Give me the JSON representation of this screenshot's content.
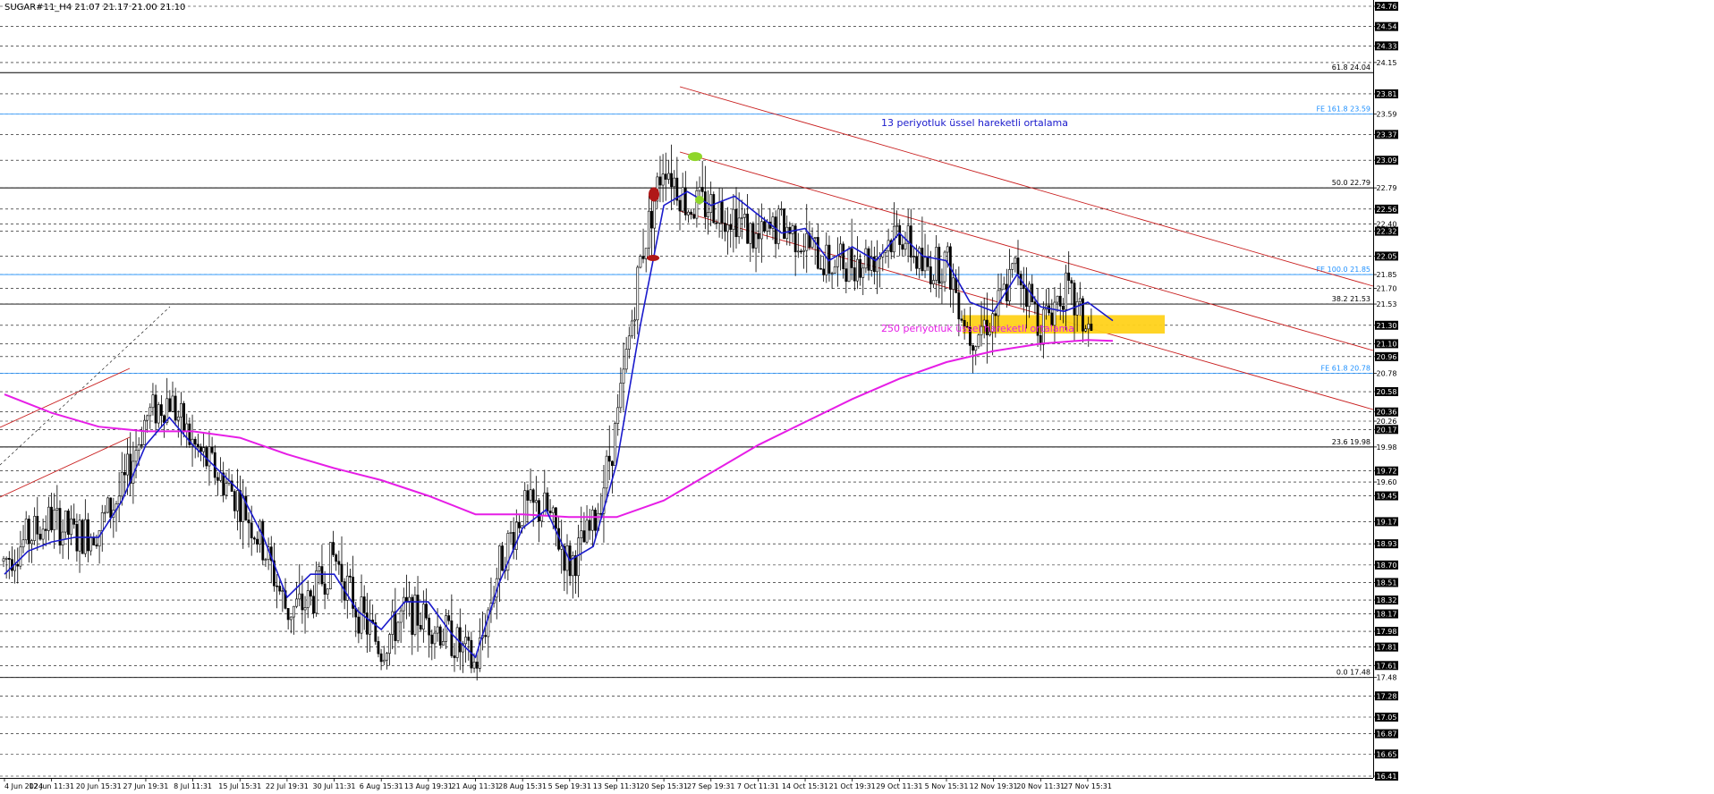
{
  "header": {
    "title": "SUGAR#11_H4  21.07 21.17 21.00 21.10"
  },
  "chart_data": {
    "type": "candlestick",
    "title": "SUGAR#11_H4  21.07 21.17 21.00 21.10",
    "symbol": "SUGAR#11",
    "timeframe": "H4",
    "last_ohlc": {
      "open": 21.07,
      "high": 21.17,
      "low": 21.0,
      "close": 21.1
    },
    "ylim": [
      16.41,
      24.76
    ],
    "grid": "horizontal-dashed",
    "y_tick_labels": [
      "24.76",
      "24.54",
      "24.33",
      "24.15",
      "23.81",
      "23.59",
      "23.37",
      "23.09",
      "22.79",
      "22.56",
      "22.40",
      "22.32",
      "22.05",
      "21.85",
      "21.70",
      "21.53",
      "21.30",
      "21.10",
      "20.96",
      "20.78",
      "20.58",
      "20.36",
      "20.26",
      "20.17",
      "19.98",
      "19.72",
      "19.60",
      "19.45",
      "19.17",
      "18.93",
      "18.70",
      "18.51",
      "18.32",
      "18.17",
      "17.98",
      "17.81",
      "17.61",
      "17.48",
      "17.28",
      "17.05",
      "16.87",
      "16.65",
      "16.41"
    ],
    "highlighted_y_ticks": [
      "24.76",
      "24.54",
      "24.33",
      "23.81",
      "23.37",
      "23.09",
      "22.56",
      "22.32",
      "22.05",
      "21.30",
      "21.10",
      "20.96",
      "20.58",
      "20.36",
      "20.17",
      "19.72",
      "19.45",
      "19.17",
      "18.93",
      "18.70",
      "18.51",
      "18.32",
      "18.17",
      "17.98",
      "17.81",
      "17.61",
      "17.28",
      "17.05",
      "16.87",
      "16.65",
      "16.41"
    ],
    "x_tick_labels": [
      "4 Jun 2024",
      "12 Jun 11:31",
      "20 Jun 15:31",
      "27 Jun 19:31",
      "8 Jul 11:31",
      "15 Jul 15:31",
      "22 Jul 19:31",
      "30 Jul 11:31",
      "6 Aug 15:31",
      "13 Aug 19:31",
      "21 Aug 11:31",
      "28 Aug 15:31",
      "5 Sep 19:31",
      "13 Sep 11:31",
      "20 Sep 15:31",
      "27 Sep 19:31",
      "7 Oct 11:31",
      "14 Oct 15:31",
      "21 Oct 19:31",
      "29 Oct 11:31",
      "5 Nov 15:31",
      "12 Nov 19:31",
      "20 Nov 11:31",
      "27 Nov 15:31"
    ],
    "levels": [
      {
        "label": "61.8 24.04",
        "value": 24.04,
        "color": "#000000"
      },
      {
        "label": "FE 161.8 23.59",
        "value": 23.59,
        "color": "#1e90ff"
      },
      {
        "label": "50.0 22.79",
        "value": 22.79,
        "color": "#000000"
      },
      {
        "label": "FE 100.0 21.85",
        "value": 21.85,
        "color": "#1e90ff"
      },
      {
        "label": "38.2 21.53",
        "value": 21.53,
        "color": "#000000"
      },
      {
        "label": "FE 61.8 20.78",
        "value": 20.78,
        "color": "#1e90ff"
      },
      {
        "label": "23.6 19.98",
        "value": 19.98,
        "color": "#000000"
      },
      {
        "label": "0.0 17.48",
        "value": 17.48,
        "color": "#000000"
      }
    ],
    "annotations": [
      {
        "text": "13 periyotluk üssel hareketli ortalama",
        "color": "#1a1acc"
      },
      {
        "text": "250 periyotluk üssel hareketli ortalama",
        "color": "#e61ee6"
      }
    ],
    "series": [
      {
        "name": "",
        "type": "candles",
        "close_path": [
          [
            "4 Jun 2024",
            18.75
          ],
          [
            "8 Jun",
            19.0
          ],
          [
            "12 Jun 11:31",
            19.2
          ],
          [
            "16 Jun",
            19.0
          ],
          [
            "20 Jun 15:31",
            19.1
          ],
          [
            "24 Jun",
            19.5
          ],
          [
            "27 Jun 19:31",
            20.3
          ],
          [
            "1 Jul",
            20.5
          ],
          [
            "8 Jul 11:31",
            20.0
          ],
          [
            "12 Jul",
            19.7
          ],
          [
            "15 Jul 15:31",
            19.4
          ],
          [
            "19 Jul",
            18.9
          ],
          [
            "22 Jul 19:31",
            18.2
          ],
          [
            "26 Jul",
            18.3
          ],
          [
            "30 Jul 11:31",
            18.8
          ],
          [
            "3 Aug",
            18.2
          ],
          [
            "6 Aug 15:31",
            17.8
          ],
          [
            "10 Aug",
            18.2
          ],
          [
            "13 Aug 19:31",
            18.1
          ],
          [
            "17 Aug",
            17.9
          ],
          [
            "21 Aug 11:31",
            17.6
          ],
          [
            "25 Aug",
            18.7
          ],
          [
            "28 Aug 15:31",
            19.3
          ],
          [
            "1 Sep",
            19.3
          ],
          [
            "5 Sep 19:31",
            18.7
          ],
          [
            "9 Sep",
            19.1
          ],
          [
            "13 Sep 11:31",
            20.2
          ],
          [
            "17 Sep",
            22.0
          ],
          [
            "20 Sep 15:31",
            23.1
          ],
          [
            "24 Sep",
            22.6
          ],
          [
            "27 Sep 19:31",
            22.6
          ],
          [
            "3 Oct",
            22.5
          ],
          [
            "7 Oct 11:31",
            22.2
          ],
          [
            "11 Oct",
            22.4
          ],
          [
            "14 Oct 15:31",
            22.2
          ],
          [
            "18 Oct",
            21.95
          ],
          [
            "21 Oct 19:31",
            22.0
          ],
          [
            "25 Oct",
            22.05
          ],
          [
            "29 Oct 11:31",
            22.35
          ],
          [
            "1 Nov",
            21.9
          ],
          [
            "5 Nov 15:31",
            22.0
          ],
          [
            "9 Nov",
            21.2
          ],
          [
            "12 Nov 19:31",
            21.4
          ],
          [
            "16 Nov",
            21.95
          ],
          [
            "20 Nov 11:31",
            21.3
          ],
          [
            "24 Nov",
            21.7
          ],
          [
            "27 Nov 15:31",
            21.25
          ],
          [
            "29 Nov",
            21.1
          ]
        ]
      },
      {
        "name": "13 periyotluk üssel hareketli ortalama",
        "color": "#1a1acc",
        "points": [
          [
            "4 Jun 2024",
            18.6
          ],
          [
            "8 Jun",
            18.85
          ],
          [
            "12 Jun 11:31",
            18.95
          ],
          [
            "16 Jun",
            19.0
          ],
          [
            "20 Jun 15:31",
            19.0
          ],
          [
            "24 Jun",
            19.4
          ],
          [
            "27 Jun 19:31",
            20.0
          ],
          [
            "1 Jul",
            20.3
          ],
          [
            "8 Jul 11:31",
            20.0
          ],
          [
            "12 Jul",
            19.75
          ],
          [
            "15 Jul 15:31",
            19.5
          ],
          [
            "19 Jul",
            19.0
          ],
          [
            "22 Jul 19:31",
            18.35
          ],
          [
            "26 Jul",
            18.6
          ],
          [
            "30 Jul 11:31",
            18.6
          ],
          [
            "3 Aug",
            18.2
          ],
          [
            "6 Aug 15:31",
            18.0
          ],
          [
            "10 Aug",
            18.3
          ],
          [
            "13 Aug 19:31",
            18.3
          ],
          [
            "17 Aug",
            17.95
          ],
          [
            "21 Aug 11:31",
            17.7
          ],
          [
            "25 Aug",
            18.5
          ],
          [
            "28 Aug 15:31",
            19.1
          ],
          [
            "1 Sep",
            19.3
          ],
          [
            "5 Sep 19:31",
            18.75
          ],
          [
            "9 Sep",
            18.9
          ],
          [
            "13 Sep 11:31",
            19.8
          ],
          [
            "17 Sep",
            21.3
          ],
          [
            "20 Sep 15:31",
            22.6
          ],
          [
            "24 Sep",
            22.75
          ],
          [
            "27 Sep 19:31",
            22.6
          ],
          [
            "3 Oct",
            22.7
          ],
          [
            "7 Oct 11:31",
            22.5
          ],
          [
            "11 Oct",
            22.3
          ],
          [
            "14 Oct 15:31",
            22.35
          ],
          [
            "18 Oct",
            22.0
          ],
          [
            "21 Oct 19:31",
            22.15
          ],
          [
            "25 Oct",
            22.0
          ],
          [
            "29 Oct 11:31",
            22.3
          ],
          [
            "1 Nov",
            22.05
          ],
          [
            "5 Nov 15:31",
            22.0
          ],
          [
            "9 Nov",
            21.55
          ],
          [
            "12 Nov 19:31",
            21.45
          ],
          [
            "16 Nov",
            21.85
          ],
          [
            "20 Nov 11:31",
            21.5
          ],
          [
            "24 Nov",
            21.45
          ],
          [
            "27 Nov 15:31",
            21.55
          ],
          [
            "29 Nov",
            21.35
          ]
        ]
      },
      {
        "name": "250 periyotluk üssel hareketli ortalama",
        "color": "#e61ee6",
        "points": [
          [
            "4 Jun 2024",
            20.55
          ],
          [
            "12 Jun 11:31",
            20.35
          ],
          [
            "20 Jun 15:31",
            20.2
          ],
          [
            "27 Jun 19:31",
            20.15
          ],
          [
            "8 Jul 11:31",
            20.15
          ],
          [
            "15 Jul 15:31",
            20.08
          ],
          [
            "22 Jul 19:31",
            19.9
          ],
          [
            "30 Jul 11:31",
            19.75
          ],
          [
            "6 Aug 15:31",
            19.62
          ],
          [
            "13 Aug 19:31",
            19.45
          ],
          [
            "21 Aug 11:31",
            19.25
          ],
          [
            "28 Aug 15:31",
            19.25
          ],
          [
            "5 Sep 19:31",
            19.22
          ],
          [
            "13 Sep 11:31",
            19.22
          ],
          [
            "20 Sep 15:31",
            19.4
          ],
          [
            "27 Sep 19:31",
            19.7
          ],
          [
            "7 Oct 11:31",
            20.0
          ],
          [
            "14 Oct 15:31",
            20.25
          ],
          [
            "21 Oct 19:31",
            20.5
          ],
          [
            "29 Oct 11:31",
            20.72
          ],
          [
            "5 Nov 15:31",
            20.9
          ],
          [
            "12 Nov 19:31",
            21.02
          ],
          [
            "20 Nov 11:31",
            21.1
          ],
          [
            "27 Nov 15:31",
            21.14
          ],
          [
            "29 Nov",
            21.13
          ]
        ]
      }
    ]
  }
}
